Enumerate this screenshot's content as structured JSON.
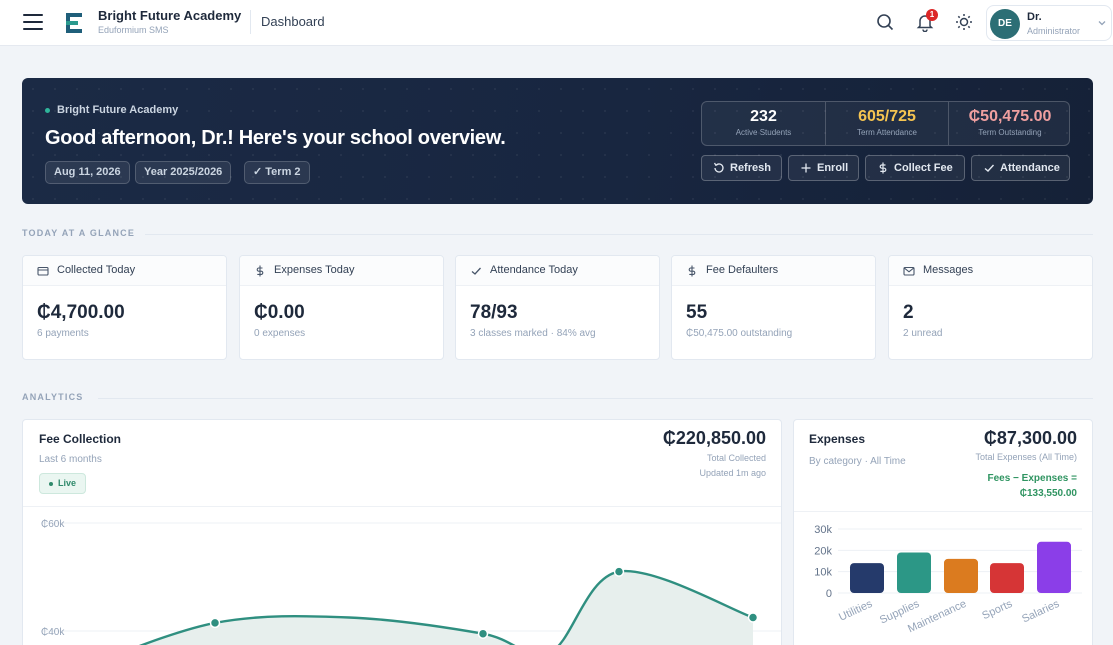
{
  "topbar": {
    "school_name": "Bright Future Academy",
    "app_name": "Eduformium SMS",
    "page_name": "Dashboard",
    "notification_count": "1",
    "user": {
      "initials": "DE",
      "name": "Dr.",
      "role": "Administrator"
    }
  },
  "hero": {
    "school_label": "Bright Future Academy",
    "greeting": "Good afternoon, Dr.! Here's your school overview.",
    "chips": [
      "Aug 11, 2026",
      "Year 2025/2026",
      "✓ Term 2"
    ],
    "stats": [
      {
        "value": "232",
        "label": "Active Students",
        "color": "#ffffff"
      },
      {
        "value": "605/725",
        "label": "Term Attendance",
        "color": "#f5c451"
      },
      {
        "value": "₵50,475.00",
        "label": "Term Outstanding",
        "color": "#f0a0a0"
      }
    ],
    "buttons": {
      "refresh": "Refresh",
      "enroll": "Enroll",
      "collect_fee": "Collect Fee",
      "attendance": "Attendance"
    }
  },
  "glance": {
    "section_title": "TODAY AT A GLANCE",
    "cards": [
      {
        "icon": "wallet-icon",
        "title": "Collected Today",
        "value": "₵4,700.00",
        "sub": "6 payments"
      },
      {
        "icon": "dollar-icon",
        "title": "Expenses Today",
        "value": "₵0.00",
        "sub": "0 expenses"
      },
      {
        "icon": "check-icon",
        "title": "Attendance Today",
        "value": "78/93",
        "sub": "3 classes marked · 84% avg"
      },
      {
        "icon": "dollar-icon",
        "title": "Fee Defaulters",
        "value": "55",
        "sub": "₵50,475.00 outstanding"
      },
      {
        "icon": "mail-icon",
        "title": "Messages",
        "value": "2",
        "sub": "2 unread"
      }
    ]
  },
  "analytics": {
    "section_title": "ANALYTICS",
    "fee_collection": {
      "title": "Fee Collection",
      "subtitle": "Last 6 months",
      "live_label": "Live",
      "total": "₵220,850.00",
      "total_label": "Total Collected",
      "updated": "Updated 1m ago",
      "y_ticks": [
        "₵60k",
        "₵40k"
      ]
    },
    "expenses": {
      "title": "Expenses",
      "subtitle": "By category · All Time",
      "total": "₵87,300.00",
      "total_label": "Total Expenses (All Time)",
      "net_label": "Fees − Expenses = ₵133,550.00"
    }
  },
  "chart_data": [
    {
      "type": "area",
      "title": "Fee Collection",
      "ylabel": "",
      "yticks": [
        "₵60k",
        "₵40k"
      ],
      "ylim": [
        20000,
        60000
      ],
      "series": [
        {
          "values": [
            33000,
            41500,
            42500,
            39500,
            36000,
            51000,
            42500
          ]
        }
      ],
      "line_color": "#2f8f80",
      "fill_color": "#e7efed",
      "markers": [
        1,
        3,
        5,
        6
      ]
    },
    {
      "type": "bar",
      "title": "Expenses",
      "categories": [
        "Utilities",
        "Supplies",
        "Maintenance",
        "Sports",
        "Salaries"
      ],
      "values": [
        14000,
        19000,
        16000,
        14000,
        24000
      ],
      "colors": [
        "#253a6b",
        "#2c9786",
        "#db7b1f",
        "#d63536",
        "#8b3ee8"
      ],
      "yticks": [
        "30k",
        "20k",
        "10k",
        "0"
      ],
      "ylim": [
        0,
        30000
      ]
    }
  ]
}
